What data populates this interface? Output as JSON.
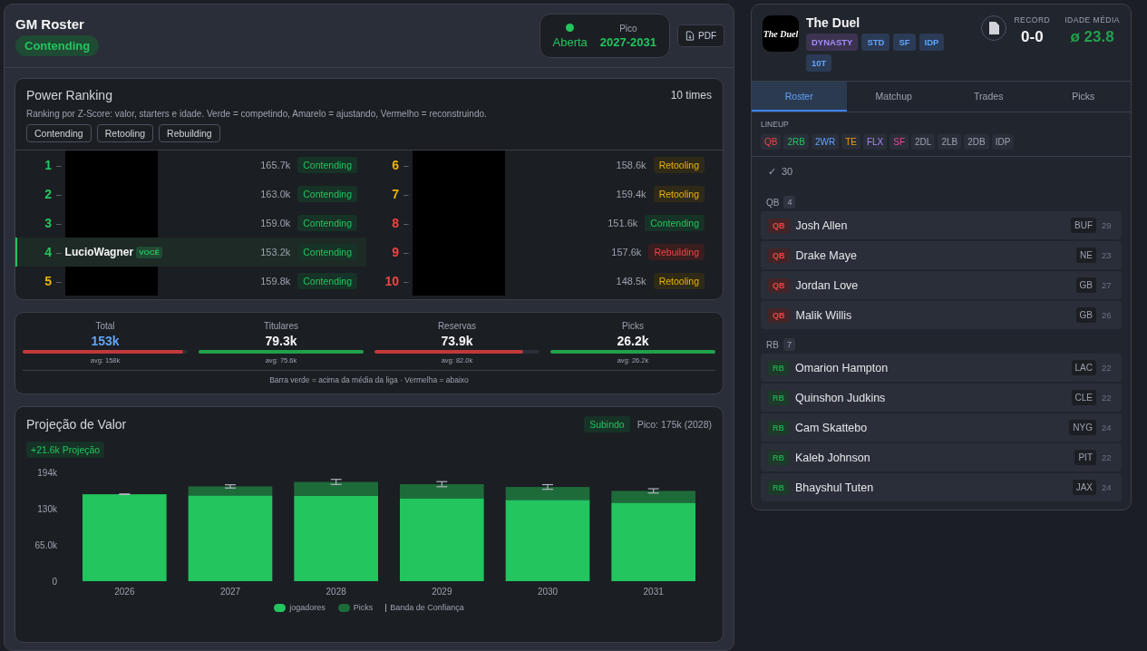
{
  "header": {
    "title": "GM Roster",
    "status": "Contending",
    "window": {
      "state": "Aberta",
      "on": true,
      "peak_label": "Pico",
      "peak": "2027-2031"
    },
    "pdf_button": "PDF"
  },
  "power_ranking": {
    "title": "Power Ranking",
    "count": "10 times",
    "description": "Ranking por Z-Score: valor, starters e idade. Verde = competindo, Amarelo = ajustando, Vermelho = reconstruindo.",
    "filters": [
      "Contending",
      "Retooling",
      "Rebuilding"
    ],
    "teams": [
      {
        "rank": "1",
        "dash": "–",
        "color": "#22c55e",
        "redacted": true,
        "value": "165.7k",
        "status": "Contending",
        "kind": "contending",
        "selected": false
      },
      {
        "rank": "2",
        "dash": "–",
        "color": "#22c55e",
        "redacted": true,
        "value": "163.0k",
        "status": "Contending",
        "kind": "contending",
        "selected": false
      },
      {
        "rank": "3",
        "dash": "–",
        "color": "#22c55e",
        "redacted": true,
        "value": "159.0k",
        "status": "Contending",
        "kind": "contending",
        "selected": false
      },
      {
        "rank": "4",
        "dash": "–",
        "color": "#22c55e",
        "redacted": false,
        "name": "LucioWagner",
        "you": "VOCÊ",
        "value": "153.2k",
        "status": "Contending",
        "kind": "contending",
        "selected": true
      },
      {
        "rank": "5",
        "dash": "–",
        "color": "#eab308",
        "redacted": true,
        "value": "159.8k",
        "status": "Contending",
        "kind": "contending",
        "selected": false
      },
      {
        "rank": "6",
        "dash": "–",
        "color": "#eab308",
        "redacted": true,
        "value": "158.6k",
        "status": "Retooling",
        "kind": "retooling",
        "selected": false
      },
      {
        "rank": "7",
        "dash": "–",
        "color": "#eab308",
        "redacted": true,
        "value": "159.4k",
        "status": "Retooling",
        "kind": "retooling",
        "selected": false
      },
      {
        "rank": "8",
        "dash": "–",
        "color": "#ef4444",
        "redacted": true,
        "value": "151.6k",
        "status": "Contending",
        "kind": "contending",
        "selected": false
      },
      {
        "rank": "9",
        "dash": "–",
        "color": "#ef4444",
        "redacted": true,
        "value": "157.6k",
        "status": "Rebuilding",
        "kind": "rebuilding",
        "selected": false
      },
      {
        "rank": "10",
        "dash": "–",
        "color": "#ef4444",
        "redacted": true,
        "value": "148.5k",
        "status": "Retooling",
        "kind": "retooling",
        "selected": false
      }
    ]
  },
  "summary": {
    "stats": [
      {
        "label": "Total",
        "value": "153k",
        "highlight": true,
        "level": 0.97,
        "above": false,
        "avg": "avg: 158k"
      },
      {
        "label": "Titulares",
        "value": "79.3k",
        "highlight": false,
        "level": 1,
        "above": true,
        "avg": "avg: 75.6k"
      },
      {
        "label": "Reservas",
        "value": "73.9k",
        "highlight": false,
        "level": 0.9,
        "above": false,
        "avg": "avg: 82.0k"
      },
      {
        "label": "Picks",
        "value": "26.2k",
        "highlight": false,
        "level": 1,
        "above": true,
        "avg": "avg: 26.2k"
      }
    ],
    "note": "Barra verde = acima da média da liga · Vermelha = abaixo"
  },
  "projection": {
    "title": "Projeção de Valor",
    "trend": "Subindo",
    "peak": "Pico: 175k (2028)",
    "delta": "+21.6k Projeção",
    "chart_data": {
      "type": "bar",
      "stacked": true,
      "categories": [
        "2026",
        "2027",
        "2028",
        "2029",
        "2030",
        "2031"
      ],
      "series": [
        {
          "name": "jogadores",
          "color": "#22c55e",
          "values": [
            155,
            153,
            152,
            148,
            145,
            140
          ]
        },
        {
          "name": "Picks",
          "color": "#1e6b3a",
          "values": [
            0,
            16,
            25,
            25,
            23,
            21
          ]
        }
      ],
      "ylim": [
        0,
        194
      ],
      "yticks": [
        {
          "value": 0,
          "label": "0"
        },
        {
          "value": 65,
          "label": "65.0k"
        },
        {
          "value": 130,
          "label": "130k"
        },
        {
          "value": 194,
          "label": "194k"
        }
      ]
    },
    "band_legend": "Banda de Confiança"
  },
  "league": {
    "logo_text": "The Duel",
    "name": "The Duel",
    "tags": [
      {
        "label": "DYNASTY",
        "kind": "purple"
      },
      {
        "label": "STD",
        "kind": "blue"
      },
      {
        "label": "SF",
        "kind": "blue"
      },
      {
        "label": "IDP",
        "kind": "blue"
      },
      {
        "label": "10T",
        "kind": "blue"
      }
    ],
    "record_label": "RECORD",
    "record": "0-0",
    "age_label": "IDADE MÉDIA",
    "age": "ø 23.8"
  },
  "tabs": [
    {
      "label": "Roster",
      "selected": true
    },
    {
      "label": "Matchup",
      "selected": false
    },
    {
      "label": "Trades",
      "selected": false
    },
    {
      "label": "Picks",
      "selected": false
    }
  ],
  "lineup": {
    "label": "LINEUP",
    "slots": [
      {
        "label": "QB",
        "color": "#ef4444"
      },
      {
        "label": "2RB",
        "color": "#22c55e"
      },
      {
        "label": "2WR",
        "color": "#60a5fa"
      },
      {
        "label": "TE",
        "color": "#f59e0b"
      },
      {
        "label": "FLX",
        "color": "#a78bfa"
      },
      {
        "label": "SF",
        "color": "#ec4899"
      },
      {
        "label": "2DL",
        "color": "#9ca3af"
      },
      {
        "label": "2LB",
        "color": "#9ca3af"
      },
      {
        "label": "2DB",
        "color": "#9ca3af"
      },
      {
        "label": "IDP",
        "color": "#9ca3af"
      }
    ]
  },
  "roster_count": {
    "check": "✓",
    "count": "30"
  },
  "groups": [
    {
      "position": "QB",
      "count": "4",
      "players": [
        {
          "pos": "QB",
          "name": "Josh Allen",
          "team": "BUF",
          "age": "29"
        },
        {
          "pos": "QB",
          "name": "Drake Maye",
          "team": "NE",
          "age": "23"
        },
        {
          "pos": "QB",
          "name": "Jordan Love",
          "team": "GB",
          "age": "27"
        },
        {
          "pos": "QB",
          "name": "Malik Willis",
          "team": "GB",
          "age": "26"
        }
      ]
    },
    {
      "position": "RB",
      "count": "7",
      "players": [
        {
          "pos": "RB",
          "name": "Omarion Hampton",
          "team": "LAC",
          "age": "22"
        },
        {
          "pos": "RB",
          "name": "Quinshon Judkins",
          "team": "CLE",
          "age": "22"
        },
        {
          "pos": "RB",
          "name": "Cam Skattebo",
          "team": "NYG",
          "age": "24"
        },
        {
          "pos": "RB",
          "name": "Kaleb Johnson",
          "team": "PIT",
          "age": "22"
        },
        {
          "pos": "RB",
          "name": "Bhayshul Tuten",
          "team": "JAX",
          "age": "24"
        }
      ]
    }
  ]
}
